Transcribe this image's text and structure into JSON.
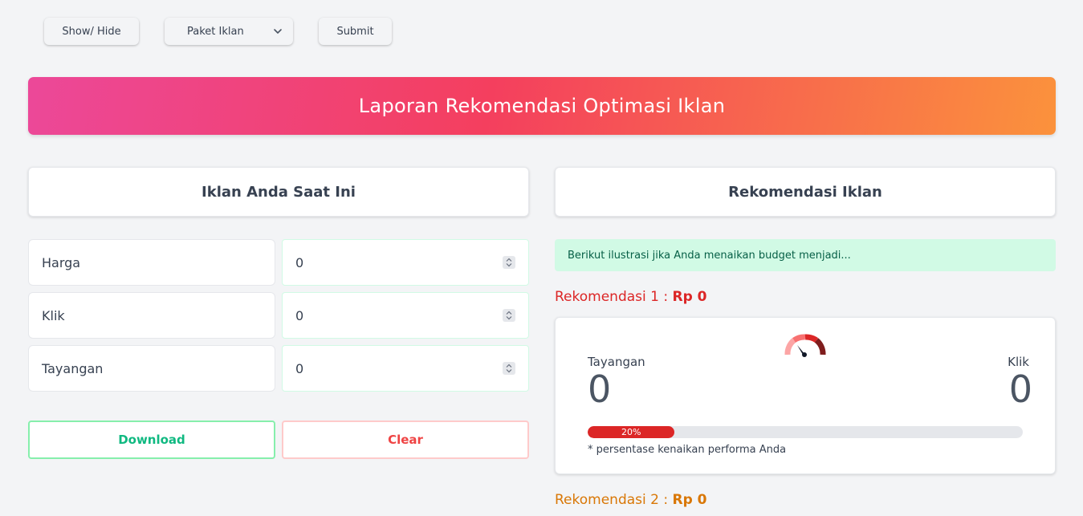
{
  "toolbar": {
    "show_hide": "Show/ Hide",
    "paket": "Paket Iklan",
    "submit": "Submit"
  },
  "banner": {
    "title": "Laporan Rekomendasi Optimasi Iklan"
  },
  "left": {
    "title": "Iklan Anda Saat Ini",
    "fields": [
      {
        "label": "Harga",
        "value": "0"
      },
      {
        "label": "Klik",
        "value": "0"
      },
      {
        "label": "Tayangan",
        "value": "0"
      }
    ],
    "download": "Download",
    "clear": "Clear"
  },
  "right": {
    "title": "Rekomendasi Iklan",
    "info": "Berikut ilustrasi jika Anda menaikan budget menjadi...",
    "rek1": {
      "label": "Rekomendasi 1 :",
      "amount": "Rp 0"
    },
    "rek2": {
      "label": "Rekomendasi 2 :",
      "amount": "Rp 0"
    },
    "card": {
      "tayangan_label": "Tayangan",
      "tayangan_value": "0",
      "klik_label": "Klik",
      "klik_value": "0",
      "progress_text": "20%",
      "progress_value": 0.2,
      "note": "* persentase kenaikan performa Anda"
    }
  },
  "colors": {
    "accent_red": "#dc2626",
    "accent_orange": "#d97706",
    "success": "#10b981",
    "danger": "#ef4444"
  }
}
